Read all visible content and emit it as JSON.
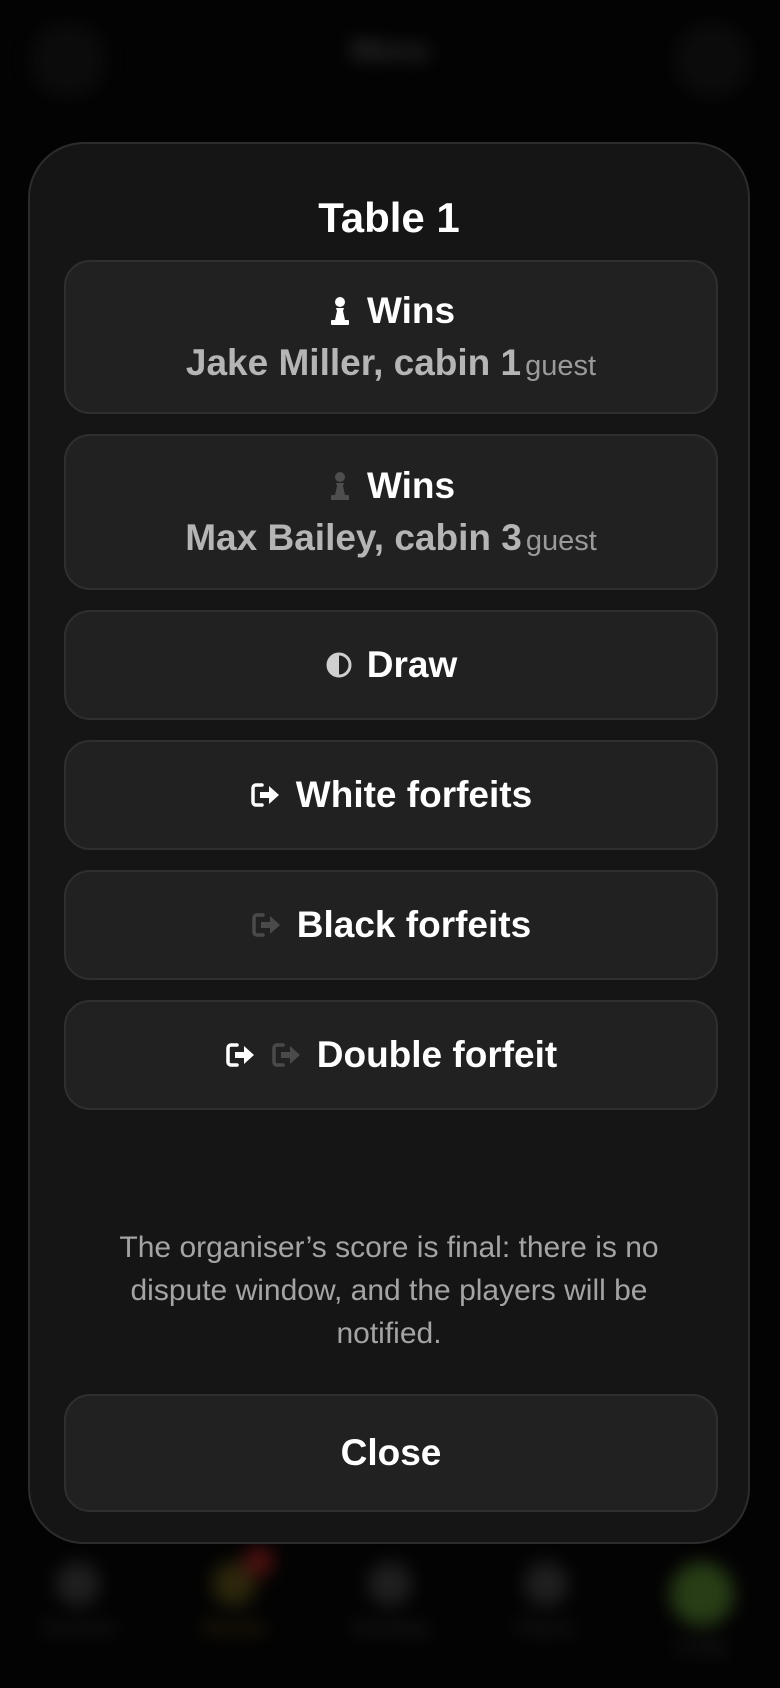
{
  "background": {
    "header_title": "Menu",
    "tabs": [
      {
        "label": "Overview"
      },
      {
        "label": "Rounds"
      },
      {
        "label": "Standings"
      },
      {
        "label": "Players"
      },
      {
        "label": "Profile"
      }
    ]
  },
  "modal": {
    "title": "Table 1",
    "options": {
      "white_wins": {
        "label": "Wins",
        "player": "Jake Miller, cabin 1",
        "tag": "guest",
        "icon": "white-pawn-icon"
      },
      "black_wins": {
        "label": "Wins",
        "player": "Max Bailey, cabin 3",
        "tag": "guest",
        "icon": "black-pawn-icon"
      },
      "draw": {
        "label": "Draw",
        "icon": "half-circle-icon"
      },
      "white_forfeits": {
        "label": "White forfeits",
        "icon": "exit-icon"
      },
      "black_forfeits": {
        "label": "Black forfeits",
        "icon": "exit-icon"
      },
      "double_forfeit": {
        "label": "Double forfeit",
        "icon": "exit-icon"
      }
    },
    "note": "The organiser’s score is final: there is no dispute window, and the players will be notified.",
    "close_label": "Close"
  },
  "colors": {
    "modal_bg": "#151515",
    "button_bg": "#212121",
    "muted_icon": "#4a4a4a",
    "text_muted": "#a4a4a4"
  }
}
